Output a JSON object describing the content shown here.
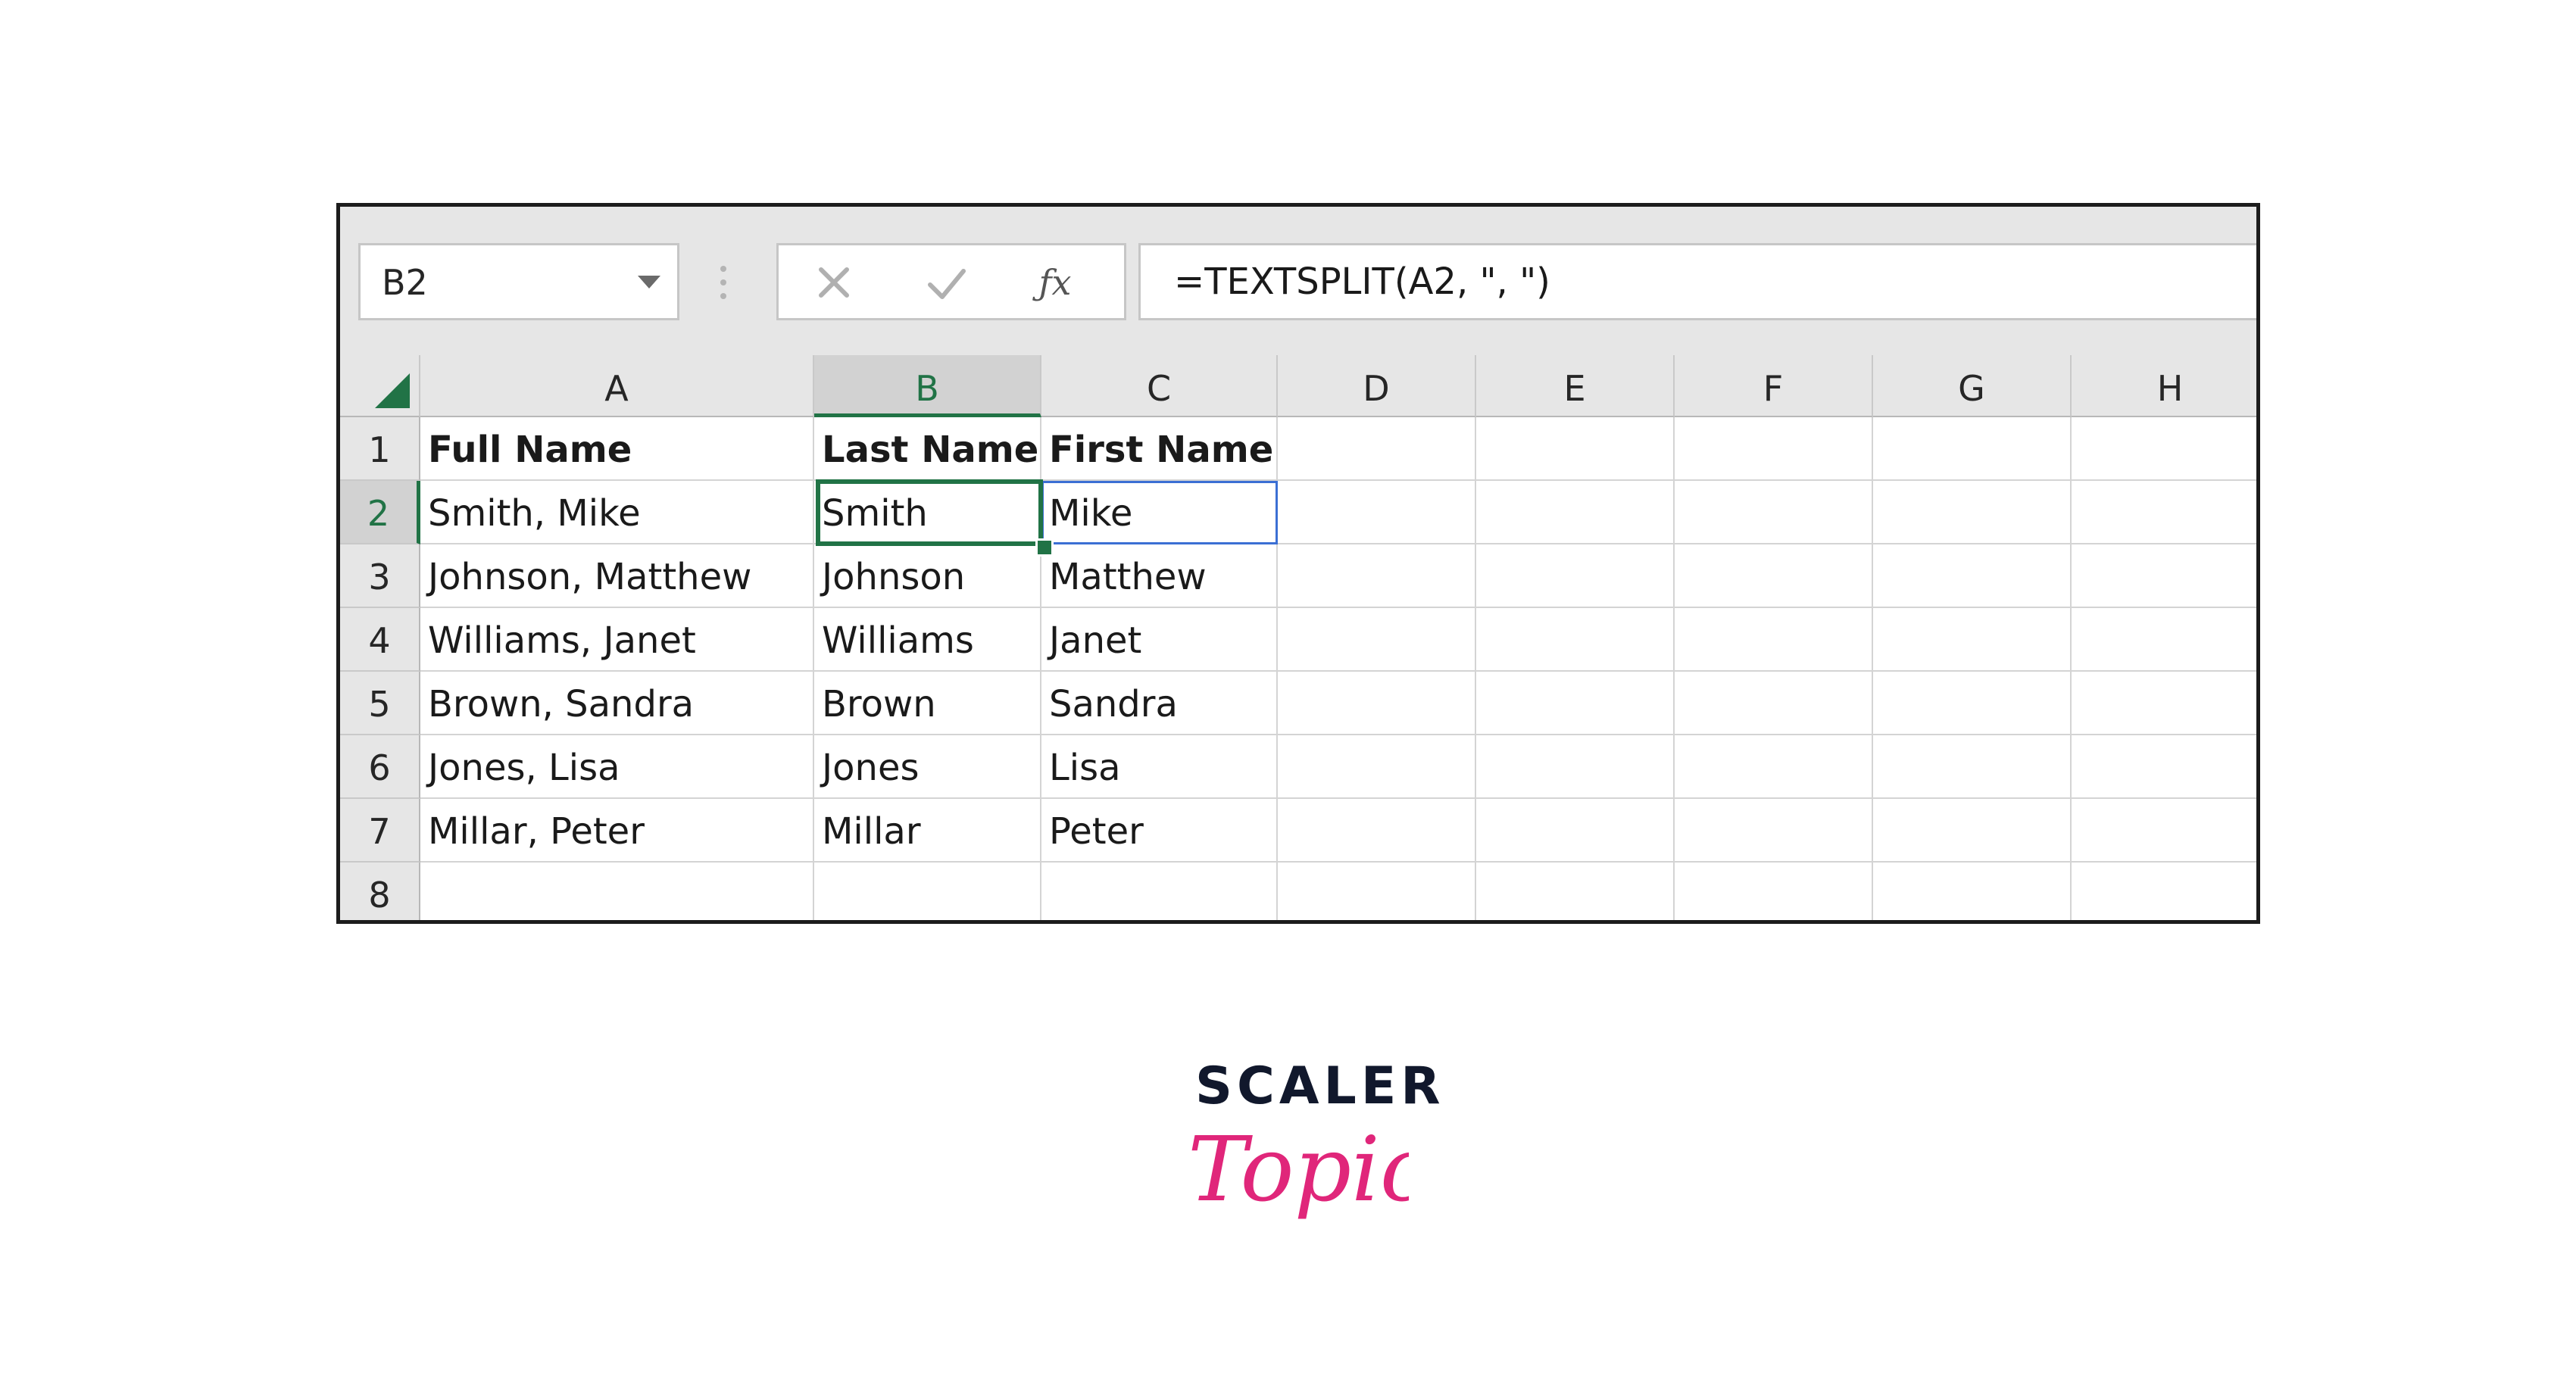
{
  "name_box": {
    "value": "B2"
  },
  "formula_bar": {
    "formula": "=TEXTSPLIT(A2, \", \")"
  },
  "columns": [
    "A",
    "B",
    "C",
    "D",
    "E",
    "F",
    "G",
    "H"
  ],
  "active_column": "B",
  "rows": [
    {
      "num": "1",
      "A": "Full Name",
      "B": "Last Name",
      "C": "First Name",
      "bold": true
    },
    {
      "num": "2",
      "A": "Smith, Mike",
      "B": "Smith",
      "C": "Mike",
      "active": true
    },
    {
      "num": "3",
      "A": "Johnson, Matthew",
      "B": "Johnson",
      "C": "Matthew"
    },
    {
      "num": "4",
      "A": "Williams, Janet",
      "B": "Williams",
      "C": "Janet"
    },
    {
      "num": "5",
      "A": "Brown, Sandra",
      "B": "Brown",
      "C": "Sandra"
    },
    {
      "num": "6",
      "A": "Jones, Lisa",
      "B": "Jones",
      "C": "Lisa"
    },
    {
      "num": "7",
      "A": "Millar, Peter",
      "B": "Millar",
      "C": "Peter"
    },
    {
      "num": "8",
      "A": "",
      "B": "",
      "C": ""
    }
  ],
  "logo": {
    "wordmark": "SCALER",
    "script": "Topics",
    "wordmark_color": "#11182c",
    "script_color": "#e0267a"
  },
  "colors": {
    "accent": "#217346",
    "spill": "#3b6fd4"
  },
  "icons": {
    "cancel": "x-icon",
    "enter": "check-icon",
    "function": "fx-icon",
    "dropdown": "chevron-down-icon"
  }
}
